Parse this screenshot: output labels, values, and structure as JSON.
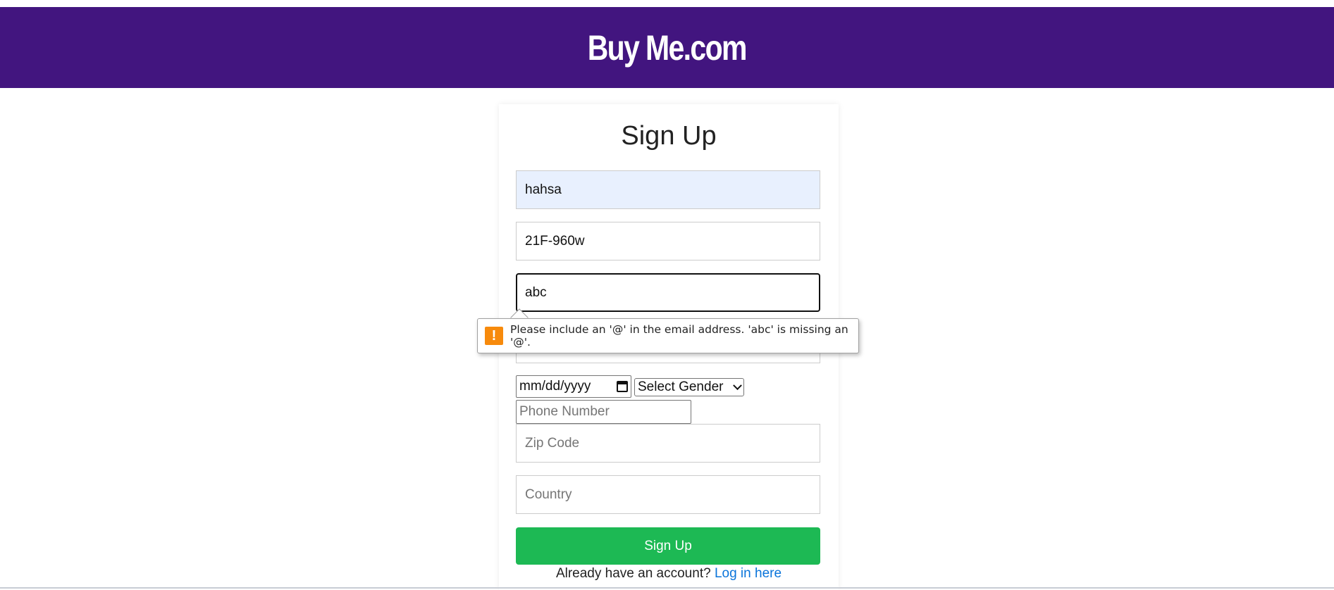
{
  "header": {
    "site_title": "Buy Me.com",
    "background": "#42157f"
  },
  "form": {
    "title": "Sign Up",
    "name_value": "hahsa",
    "id_value": "21F-960w",
    "email_value": "abc",
    "password_value": "",
    "date_placeholder": "mm/dd/yyyy",
    "gender_selected": "Select Gender",
    "phone_placeholder": "Phone Number",
    "zip_placeholder": "Zip Code",
    "country_placeholder": "Country",
    "submit_label": "Sign Up",
    "submit_color": "#1db954",
    "login_prompt": "Already have an account?",
    "login_link": "Log in here"
  },
  "validation": {
    "icon": "warning-icon",
    "message": "Please include an '@' in the email address. 'abc' is missing an '@'."
  }
}
